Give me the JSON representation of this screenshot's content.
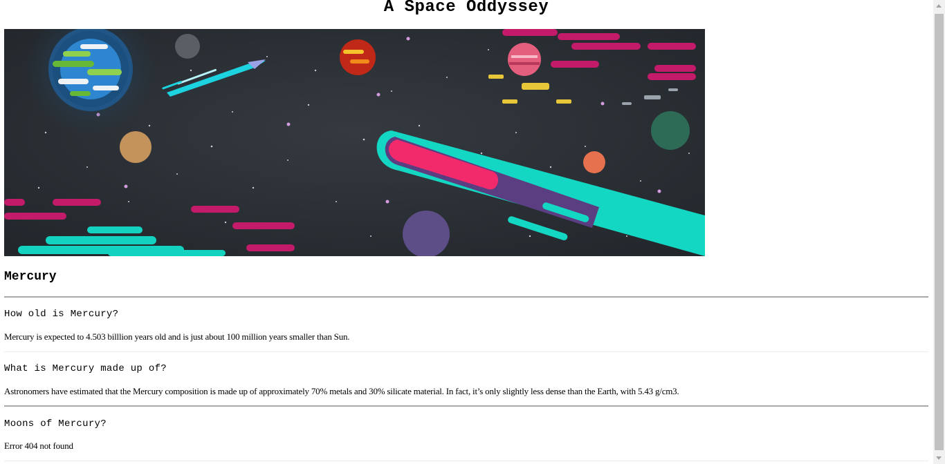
{
  "page": {
    "title": "A Space Oddyssey"
  },
  "banner": {
    "icon": "space-illustration",
    "colors": {
      "background": "#2b3036",
      "comet_head": "#f2296b",
      "comet_tail": "#14d7c3",
      "accent_magenta": "#c31a6a"
    }
  },
  "article": {
    "heading": "Mercury",
    "sections": [
      {
        "question": "How old is Mercury?",
        "answer": "Mercury is expected to 4.503 billlion years old and is just about 100 million years smaller than Sun."
      },
      {
        "question": "What is Mercury made up of?",
        "answer": "Astronomers have estimated that the Mercury composition is made up of approximately 70% metals and 30% silicate material. In fact, it’s only slightly less dense than the Earth, with 5.43 g/cm3."
      },
      {
        "question": "Moons of Mercury?",
        "answer": "Error 404 not found"
      }
    ]
  }
}
